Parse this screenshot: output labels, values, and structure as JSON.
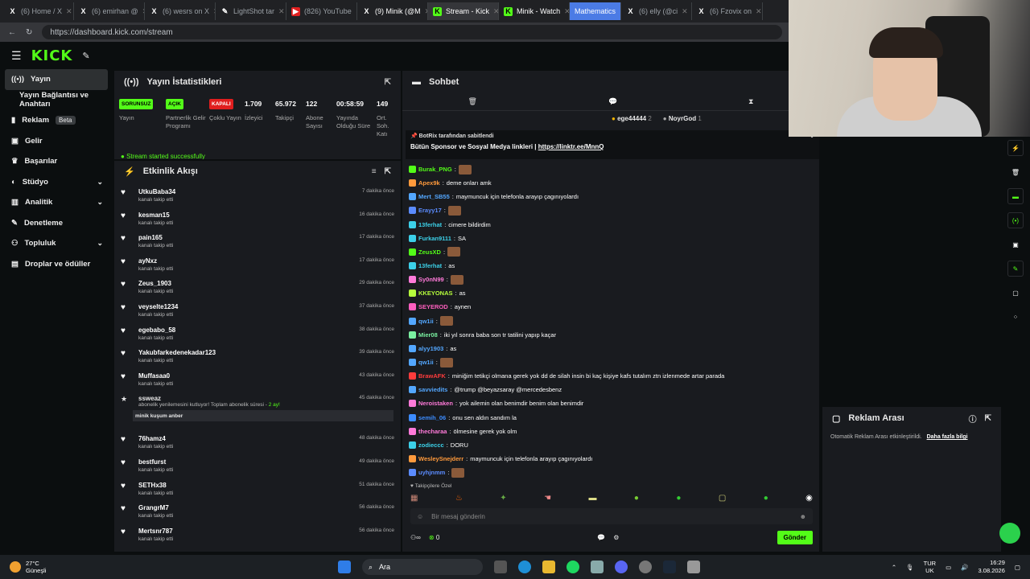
{
  "browser": {
    "tabs": [
      {
        "label": "(6) Home / X",
        "icon": "x-icon"
      },
      {
        "label": "(6) emirhan @",
        "icon": "x-icon"
      },
      {
        "label": "(6) wesrs on X",
        "icon": "x-icon"
      },
      {
        "label": "LightShot tar",
        "icon": "feather-icon"
      },
      {
        "label": "(826) YouTube",
        "icon": "youtube-icon"
      },
      {
        "label": "(9) Minik (@M",
        "icon": "x-icon"
      },
      {
        "label": "Stream - Kick",
        "icon": "kick-icon",
        "active": true
      },
      {
        "label": "Minik - Watch",
        "icon": "kick-icon"
      },
      {
        "label": "Mathematics",
        "icon": "none"
      },
      {
        "label": "(6) elly (@ci",
        "icon": "x-icon"
      },
      {
        "label": "(6) Fzovix on",
        "icon": "x-icon"
      }
    ],
    "url": "https://dashboard.kick.com/stream"
  },
  "kick": {
    "logo": "KICK"
  },
  "sidebar": {
    "items": [
      {
        "label": "Yayın",
        "icon": "broadcast-icon",
        "active": true
      },
      {
        "label": "Yayın Bağlantısı ve Anahtarı",
        "icon": ""
      },
      {
        "label": "Reklam",
        "icon": "megaphone-icon",
        "badge": "Beta"
      },
      {
        "label": "Gelir",
        "icon": "wallet-icon"
      },
      {
        "label": "Başarılar",
        "icon": "trophy-icon"
      },
      {
        "label": "Stüdyo",
        "icon": "palette-icon",
        "chevron": true
      },
      {
        "label": "Analitik",
        "icon": "chart-icon",
        "chevron": true
      },
      {
        "label": "Denetleme",
        "icon": "wrench-icon"
      },
      {
        "label": "Topluluk",
        "icon": "community-icon",
        "chevron": true
      },
      {
        "label": "Droplar ve ödüller",
        "icon": "gift-icon"
      }
    ]
  },
  "stats": {
    "title": "Yayın İstatistikleri",
    "items": [
      {
        "value": "SORUNSUZ",
        "label": "Yayın",
        "pill": "green"
      },
      {
        "value": "AÇIK",
        "label": "Partnerlik Gelir Programı",
        "pill": "green"
      },
      {
        "value": "KAPALI",
        "label": "Çoklu Yayın",
        "pill": "red"
      },
      {
        "value": "1.709",
        "label": "İzleyici"
      },
      {
        "value": "65.972",
        "label": "Takipçi"
      },
      {
        "value": "122",
        "label": "Abone Sayısı"
      },
      {
        "value": "00:58:59",
        "label": "Yayında Olduğu Süre"
      },
      {
        "value": "149",
        "label": "Ort. Soh. Katı"
      }
    ],
    "status_msg": "Stream started successfully"
  },
  "activity": {
    "title": "Etkinlik Akışı",
    "events": [
      {
        "name": "UtkuBaba34",
        "sub": "kanalı takip etti",
        "time": "7 dakika önce"
      },
      {
        "name": "kesman15",
        "sub": "kanalı takip etti",
        "time": "16 dakika önce"
      },
      {
        "name": "pain165",
        "sub": "kanalı takip etti",
        "time": "17 dakika önce"
      },
      {
        "name": "ayNxz",
        "sub": "kanalı takip etti",
        "time": "17 dakika önce"
      },
      {
        "name": "Zeus_1903",
        "sub": "kanalı takip etti",
        "time": "29 dakika önce"
      },
      {
        "name": "veyselte1234",
        "sub": "kanalı takip etti",
        "time": "37 dakika önce"
      },
      {
        "name": "egebabo_58",
        "sub": "kanalı takip etti",
        "time": "38 dakika önce"
      },
      {
        "name": "Yakubfarkedenekadar123",
        "sub": "kanalı takip etti",
        "time": "39 dakika önce"
      },
      {
        "name": "Muffasaa0",
        "sub": "kanalı takip etti",
        "time": "43 dakika önce"
      }
    ],
    "sub_event": {
      "name": "ssweaz",
      "time": "45 dakika önce",
      "text": "abonelik yenilemesini kutluyor! Toplam abonelik süresi -",
      "months": "2 ay!",
      "gift": "minik kuşum anber"
    },
    "events2": [
      {
        "name": "76hamz4",
        "sub": "kanalı takip etti",
        "time": "48 dakika önce"
      },
      {
        "name": "bestfurst",
        "sub": "kanalı takip etti",
        "time": "49 dakika önce"
      },
      {
        "name": "SETHx38",
        "sub": "kanalı takip etti",
        "time": "51 dakika önce"
      },
      {
        "name": "GrangrM7",
        "sub": "kanalı takip etti",
        "time": "56 dakika önce"
      },
      {
        "name": "Mertsnr787",
        "sub": "kanalı takip etti",
        "time": "56 dakika önce"
      }
    ]
  },
  "chat": {
    "title": "Sohbet",
    "gifters": [
      {
        "name": "ege44444",
        "count": "2"
      },
      {
        "name": "NoyrGod",
        "count": "1"
      }
    ],
    "pinned_by": "BotRix tarafından sabitlendi",
    "pinned_text": "Bütün Sponsor ve Sosyal Medya linkleri |",
    "pinned_link": "https://linktr.ee/MnnQ",
    "messages": [
      {
        "user": "Burak_PNG",
        "color": "#53fc18",
        "text": "",
        "emote": true
      },
      {
        "user": "Apex9k",
        "color": "#ff9a3c",
        "text": "deme onları amk"
      },
      {
        "user": "Mert_SB55",
        "color": "#53a7ff",
        "text": "maymuncuk için telefonla arayıp çagınıyolardı"
      },
      {
        "user": "Erayy17",
        "color": "#5b8cff",
        "text": "",
        "emote": true
      },
      {
        "user": "13ferhat",
        "color": "#3cd0e8",
        "text": "cimere bildirdim"
      },
      {
        "user": "Furkan9111",
        "color": "#3cd0e8",
        "text": "SA"
      },
      {
        "user": "ZeusXD",
        "color": "#53fc18",
        "text": "",
        "emote": true
      },
      {
        "user": "13ferhat",
        "color": "#3cd0e8",
        "text": "as"
      },
      {
        "user": "Sy0nN99",
        "color": "#ff7ad9",
        "text": "",
        "emote": true
      },
      {
        "user": "KKEYONAS",
        "color": "#b7ff3c",
        "text": "as"
      },
      {
        "user": "SEYEROD",
        "color": "#ff5fbf",
        "text": "aynen"
      },
      {
        "user": "qw1ii",
        "color": "#53a7ff",
        "text": "",
        "emote": true
      },
      {
        "user": "Mier08",
        "color": "#7af0a0",
        "text": "iki yıl sonra baba son tr tatilini yapıp kaçar"
      },
      {
        "user": "alyy1903",
        "color": "#53a7ff",
        "text": "as"
      },
      {
        "user": "qw1ii",
        "color": "#53a7ff",
        "text": "",
        "emote": true
      },
      {
        "user": "BrawAFK",
        "color": "#ff3c3c",
        "text": "miniğim tetikçi olmana gerek yok dd de silah insin bi kaç kişiye kafs tutalım ztn izlenmede artar parada"
      },
      {
        "user": "savviedits",
        "color": "#53a7ff",
        "text": "@trump @beyazsaray @mercedesbenz"
      },
      {
        "user": "Neroistaken",
        "color": "#ff7ad9",
        "text": "yok ailemin olan benimdir benim olan benimdir"
      },
      {
        "user": "semih_06",
        "color": "#3c8cff",
        "text": "onu sen aldın sandım la"
      },
      {
        "user": "thecharaa",
        "color": "#ff7ad9",
        "text": "ölmesine gerek yok olm"
      },
      {
        "user": "zodieccc",
        "color": "#3cd0e8",
        "text": "DORU"
      },
      {
        "user": "WesleySnejderr",
        "color": "#ff9a3c",
        "text": "maymuncuk için telefonla arayıp çagınıyolardı"
      },
      {
        "user": "uyhjnmm",
        "color": "#5b8cff",
        "text": "",
        "emote": true
      }
    ],
    "followers_only": "Takipçilere Özel",
    "input_placeholder": "Bir mesaj gönderin",
    "viewer_count": "0",
    "send_label": "Gönder"
  },
  "adbreak": {
    "title": "Reklam Arası",
    "text": "Otomatik Reklam Arası etkinleştirildi.",
    "link": "Daha fazla bilgi"
  },
  "taskbar": {
    "temp": "27°C",
    "weather": "Güneşli",
    "search": "Ara",
    "lang": "TUR",
    "region": "UK",
    "time": "16:29",
    "date": "3.08.2026"
  },
  "colors": {
    "accent": "#53fc18",
    "red": "#e01e1e",
    "panel": "#191b1f"
  }
}
